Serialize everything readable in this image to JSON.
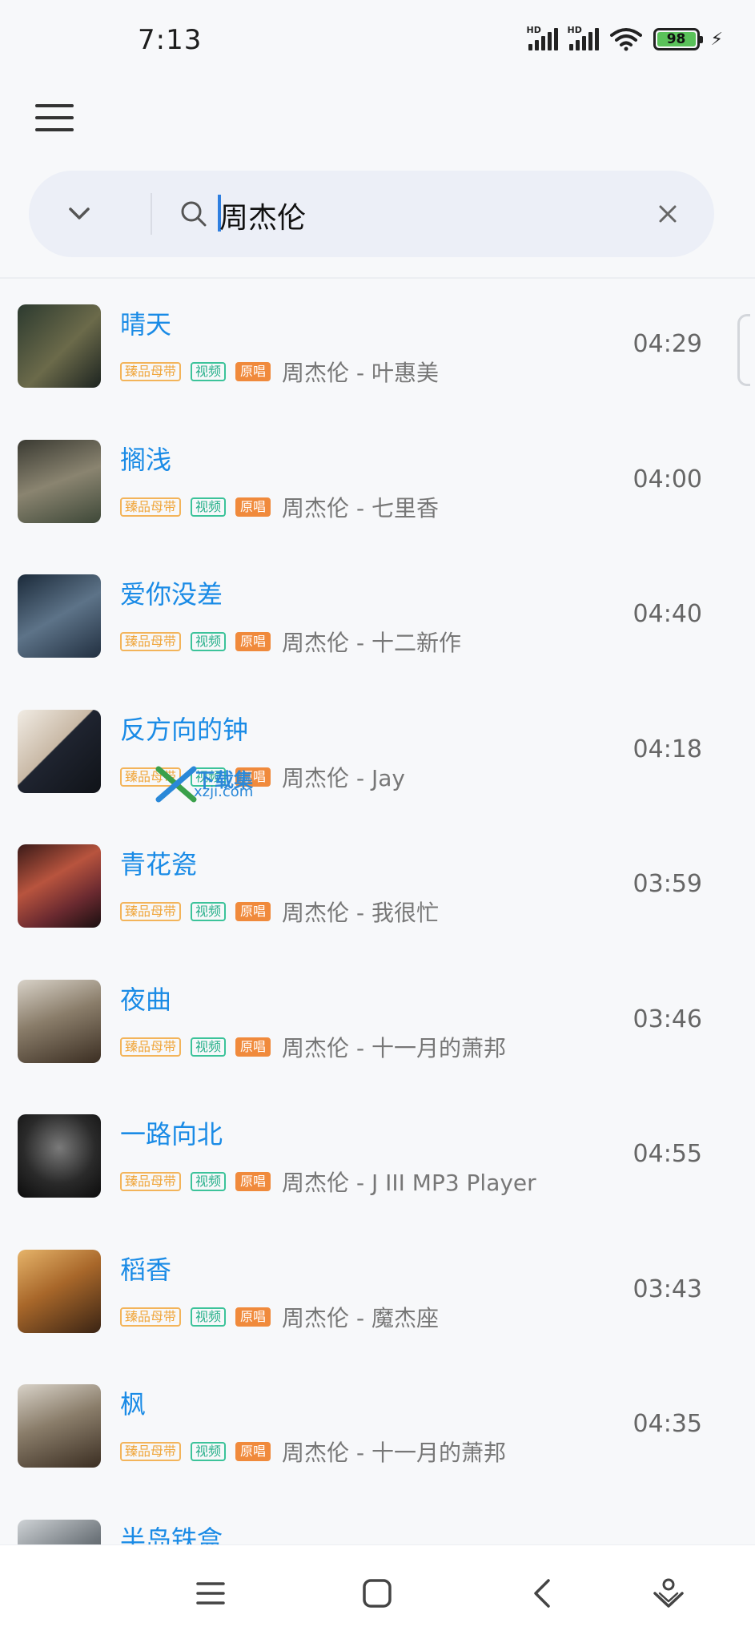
{
  "status_bar": {
    "time": "7:13",
    "sim1": "HD",
    "sim2": "HD",
    "battery_level": "98"
  },
  "search": {
    "query": "周杰伦"
  },
  "icons": {
    "menu": "menu-icon",
    "dropdown": "chevron-down-icon",
    "search": "search-icon",
    "clear": "close-icon",
    "nav_menu": "menu-icon",
    "nav_home": "square-icon",
    "nav_back": "back-icon",
    "nav_assist": "assistant-icon"
  },
  "tags": {
    "master": "臻品母带",
    "video": "视频",
    "original": "原唱"
  },
  "songs": [
    {
      "title": "晴天",
      "artist_album": "周杰伦 - 叶惠美",
      "duration": "04:29"
    },
    {
      "title": "搁浅",
      "artist_album": "周杰伦 - 七里香",
      "duration": "04:00"
    },
    {
      "title": "爱你没差",
      "artist_album": "周杰伦 - 十二新作",
      "duration": "04:40"
    },
    {
      "title": "反方向的钟",
      "artist_album": "周杰伦 - Jay",
      "duration": "04:18"
    },
    {
      "title": "青花瓷",
      "artist_album": "周杰伦 - 我很忙",
      "duration": "03:59"
    },
    {
      "title": "夜曲",
      "artist_album": "周杰伦 - 十一月的萧邦",
      "duration": "03:46"
    },
    {
      "title": "一路向北",
      "artist_album": "周杰伦 - J III MP3 Player",
      "duration": "04:55"
    },
    {
      "title": "稻香",
      "artist_album": "周杰伦 - 魔杰座",
      "duration": "03:43"
    },
    {
      "title": "枫",
      "artist_album": "周杰伦 - 十一月的萧邦",
      "duration": "04:35"
    },
    {
      "title": "半岛铁盒",
      "artist_album": "",
      "duration": ""
    }
  ],
  "watermark": {
    "top": "下载集",
    "bottom": "xzji.com"
  },
  "colors": {
    "title_blue": "#1a8be6",
    "tag_master": "#f0a63c",
    "tag_video": "#27b08a",
    "tag_original": "#f08a3c"
  }
}
